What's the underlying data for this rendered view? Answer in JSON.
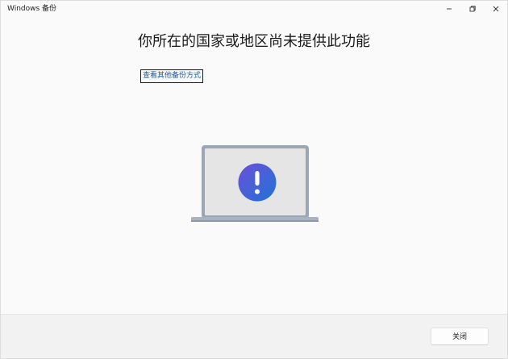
{
  "window": {
    "title": "Windows 备份"
  },
  "main": {
    "heading": "你所在的国家或地区尚未提供此功能",
    "alt_link": "查看其他备份方式",
    "illustration_icon": "exclamation-icon"
  },
  "footer": {
    "close_label": "关闭"
  },
  "colors": {
    "accent_gradient_start": "#6b4fd8",
    "accent_gradient_end": "#1f74d6",
    "link": "#1b5a9c"
  }
}
